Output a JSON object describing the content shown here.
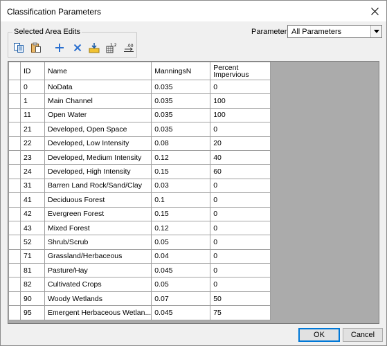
{
  "window": {
    "title": "Classification Parameters"
  },
  "toolbar": {
    "group_label": "Selected Area Edits",
    "buttons": [
      "copy-icon",
      "paste-icon",
      "add-icon",
      "delete-icon",
      "fill-icon",
      "number-format-icon",
      "decimal-icon"
    ],
    "number_format_text": "1.2",
    "decimal_text": ".00"
  },
  "parameter": {
    "label": "Parameter:",
    "value": "All Parameters"
  },
  "table": {
    "columns": [
      "ID",
      "Name",
      "ManningsN",
      "Percent Impervious"
    ],
    "rows": [
      [
        "0",
        "NoData",
        "0.035",
        "0"
      ],
      [
        "1",
        "Main Channel",
        "0.035",
        "100"
      ],
      [
        "11",
        "Open Water",
        "0.035",
        "100"
      ],
      [
        "21",
        "Developed, Open Space",
        "0.035",
        "0"
      ],
      [
        "22",
        "Developed, Low Intensity",
        "0.08",
        "20"
      ],
      [
        "23",
        "Developed, Medium Intensity",
        "0.12",
        "40"
      ],
      [
        "24",
        "Developed, High Intensity",
        "0.15",
        "60"
      ],
      [
        "31",
        "Barren Land Rock/Sand/Clay",
        "0.03",
        "0"
      ],
      [
        "41",
        "Deciduous Forest",
        "0.1",
        "0"
      ],
      [
        "42",
        "Evergreen Forest",
        "0.15",
        "0"
      ],
      [
        "43",
        "Mixed Forest",
        "0.12",
        "0"
      ],
      [
        "52",
        "Shrub/Scrub",
        "0.05",
        "0"
      ],
      [
        "71",
        "Grassland/Herbaceous",
        "0.04",
        "0"
      ],
      [
        "81",
        "Pasture/Hay",
        "0.045",
        "0"
      ],
      [
        "82",
        "Cultivated Crops",
        "0.05",
        "0"
      ],
      [
        "90",
        "Woody Wetlands",
        "0.07",
        "50"
      ],
      [
        "95",
        "Emergent Herbaceous Wetlan...",
        "0.045",
        "75"
      ]
    ]
  },
  "buttons": {
    "ok": "OK",
    "cancel": "Cancel"
  },
  "colors": {
    "grid_bg": "#ababab",
    "window_bg": "#f0f0f0",
    "accent": "#0078d7"
  }
}
